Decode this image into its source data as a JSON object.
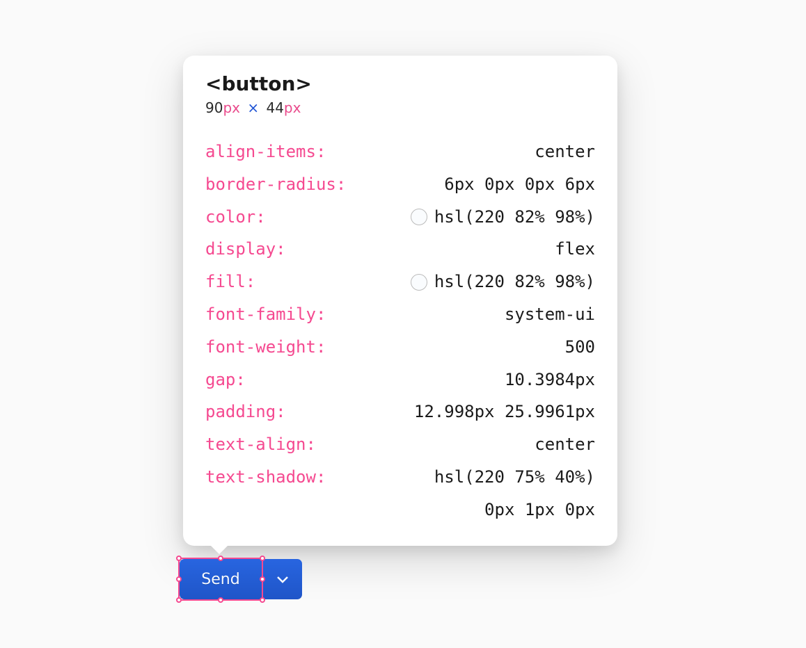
{
  "tooltip": {
    "element_tag": "<button>",
    "dimensions": {
      "width": "90",
      "width_unit": "px",
      "times": "×",
      "height": "44",
      "height_unit": "px"
    },
    "properties": [
      {
        "name": "align-items",
        "colon": ":",
        "value": "center",
        "has_swatch": false
      },
      {
        "name": "border-radius",
        "colon": ":",
        "value": "6px 0px 0px 6px",
        "has_swatch": false
      },
      {
        "name": "color",
        "colon": ":",
        "value": "hsl(220 82% 98%)",
        "has_swatch": true
      },
      {
        "name": "display",
        "colon": ":",
        "value": "flex",
        "has_swatch": false
      },
      {
        "name": "fill",
        "colon": ":",
        "value": "hsl(220 82% 98%)",
        "has_swatch": true
      },
      {
        "name": "font-family",
        "colon": ":",
        "value": "system-ui",
        "has_swatch": false
      },
      {
        "name": "font-weight",
        "colon": ":",
        "value": "500",
        "has_swatch": false
      },
      {
        "name": "gap",
        "colon": ":",
        "value": "10.3984px",
        "has_swatch": false
      },
      {
        "name": "padding",
        "colon": ":",
        "value": "12.998px 25.9961px",
        "has_swatch": false
      },
      {
        "name": "text-align",
        "colon": ":",
        "value": "center",
        "has_swatch": false
      },
      {
        "name": "text-shadow",
        "colon": ":",
        "value": "hsl(220 75% 40%)",
        "value2": "0px 1px 0px",
        "has_swatch": false,
        "multiline": true
      }
    ]
  },
  "button": {
    "send_label": "Send"
  }
}
